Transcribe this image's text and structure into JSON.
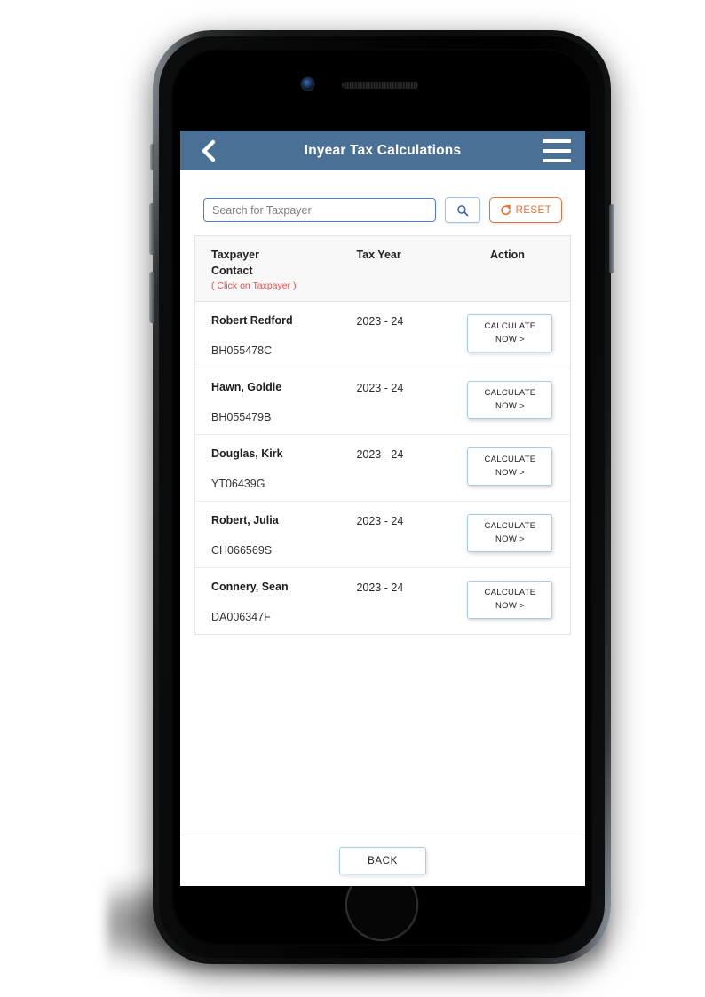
{
  "appbar": {
    "title": "Inyear Tax Calculations",
    "back_icon": "chevron-left-icon",
    "menu_icon": "hamburger-menu-icon",
    "background_color": "#4b7096"
  },
  "search": {
    "placeholder": "Search for Taxpayer",
    "value": "",
    "submit_icon": "search-icon",
    "reset_label": "RESET",
    "reset_icon": "refresh-icon",
    "reset_color": "#e8713a",
    "input_border_color": "#4a7fd4"
  },
  "table": {
    "headers": {
      "name": "Taxpayer",
      "contact": "Contact",
      "hint": "( Click on Taxpayer )",
      "hint_color": "#ef4b4b",
      "year": "Tax Year",
      "action": "Action"
    },
    "rows": [
      {
        "name": "Robert Redford",
        "nino": "BH055478C",
        "tax_year": "2023 - 24",
        "action_line1": "CALCULATE",
        "action_line2": "NOW  >"
      },
      {
        "name": "Hawn, Goldie",
        "nino": "BH055479B",
        "tax_year": "2023 - 24",
        "action_line1": "CALCULATE",
        "action_line2": "NOW  >"
      },
      {
        "name": "Douglas, Kirk",
        "nino": "YT06439G",
        "tax_year": "2023 - 24",
        "action_line1": "CALCULATE",
        "action_line2": "NOW  >"
      },
      {
        "name": "Robert, Julia",
        "nino": "CH066569S",
        "tax_year": "2023 - 24",
        "action_line1": "CALCULATE",
        "action_line2": "NOW  >"
      },
      {
        "name": "Connery, Sean",
        "nino": "DA006347F",
        "tax_year": "2023 - 24",
        "action_line1": "CALCULATE",
        "action_line2": "NOW  >"
      }
    ]
  },
  "footer": {
    "back_label": "BACK"
  },
  "device": {
    "camera_icon": "front-camera-icon",
    "earpiece_icon": "earpiece-speaker-icon",
    "home_icon": "home-button-icon"
  }
}
